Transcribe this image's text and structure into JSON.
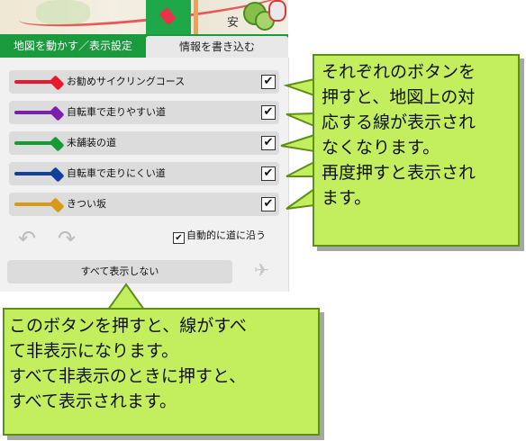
{
  "map": {
    "town_label": "安"
  },
  "tabs": {
    "active": "地図を動かす／表示設定",
    "inactive": "情報を書き込む"
  },
  "rows": [
    {
      "label": "お勧めサイクリングコース",
      "color": "#e8192c",
      "checked": true
    },
    {
      "label": "自転車で走りやすい道",
      "color": "#7b1fb0",
      "checked": true
    },
    {
      "label": "未舗装の道",
      "color": "#149b32",
      "checked": true
    },
    {
      "label": "自転車で走りにくい道",
      "color": "#123f9c",
      "checked": true
    },
    {
      "label": "きつい坂",
      "color": "#d49a18",
      "checked": true
    }
  ],
  "check_mark": "✔",
  "auto_follow": {
    "label": "自動的に道に沿う",
    "checked": true
  },
  "hide_all_button": "すべて表示しない",
  "icons": {
    "undo": "undo-arrow-icon",
    "redo": "redo-arrow-icon",
    "tool": "satellite-tool-icon",
    "tag": "tag-icon"
  },
  "callout_right": [
    "それぞれのボタンを",
    "押すと、地図上の対",
    "応する線が表示され",
    "なくなります。",
    "再度押すと表示され",
    "ます。"
  ],
  "callout_bottom": [
    "このボタンを押すと、線がすべ",
    "て非表示になります。",
    "すべて非表示のときに押すと、",
    "すべて表示されます。"
  ],
  "colors": {
    "accent": "#1a9a3d",
    "callout": "#c3ef5e"
  }
}
